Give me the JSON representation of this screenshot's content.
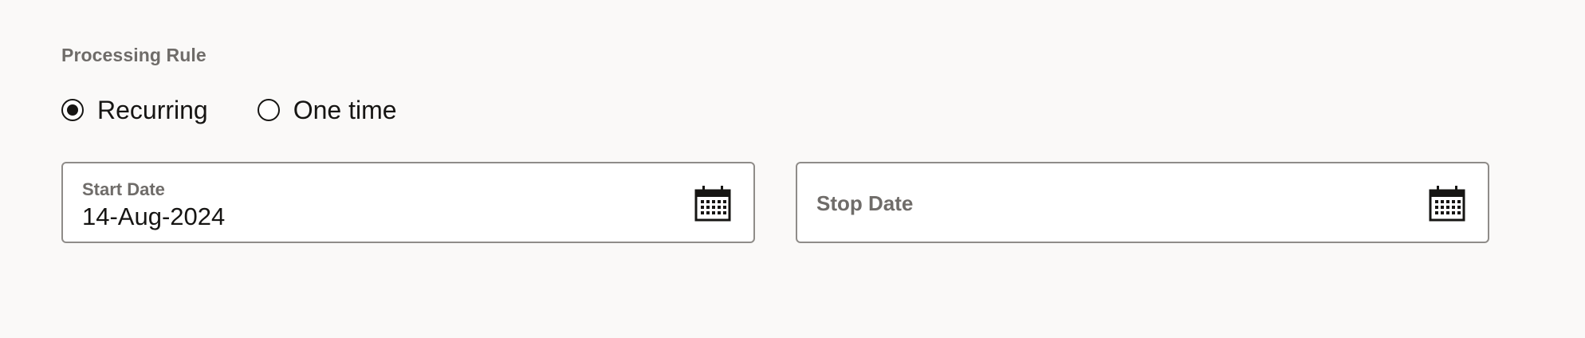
{
  "section": {
    "title": "Processing Rule"
  },
  "processing_rule": {
    "options": [
      {
        "label": "Recurring",
        "selected": true
      },
      {
        "label": "One time",
        "selected": false
      }
    ]
  },
  "start_date": {
    "label": "Start Date",
    "value": "14-Aug-2024",
    "icon": "calendar-icon"
  },
  "stop_date": {
    "label": "Stop Date",
    "value": "",
    "icon": "calendar-icon"
  }
}
